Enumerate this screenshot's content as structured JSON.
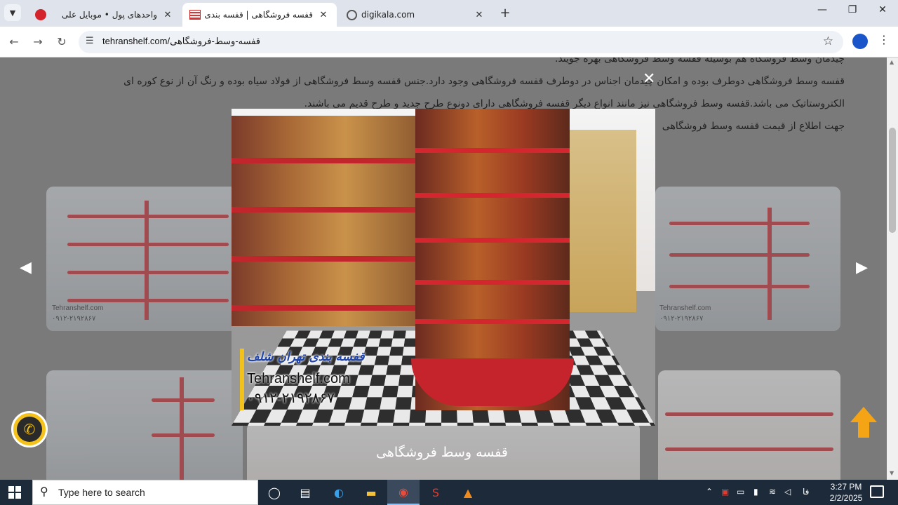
{
  "browser": {
    "tabs": [
      {
        "title": "واحدهای پول • موبایل علی",
        "favicon": "red-circle-icon",
        "active": false
      },
      {
        "title": "قفسه فروشگاهی | قفسه بندی فروشگاه",
        "favicon": "tehranshelf-icon",
        "active": true
      },
      {
        "title": "digikala.com",
        "favicon": "globe-icon",
        "active": false
      }
    ],
    "new_tab_symbol": "+",
    "url": "tehranshelf.com/قفسه-وسط-فروشگاهی"
  },
  "article": {
    "lines": [
      "چیدمان وسط فروشگاه هم بوسیله قفسه وسط فروشگاهی بهره جویند.",
      "قفسه وسط فروشگاهی دوطرف بوده و امکان چیدمان اجناس در دوطرف قفسه فروشگاهی وجود دارد.جنس قفسه وسط فروشگاهی از فولاد سیاه بوده و رنگ آن از نوع کوره ای",
      "الکتروستاتیک می باشد.قفسه وسط فروشگاهی نیز مانند انواع دیگر قفسه فروشگاهی دارای دونوع طرح جدید و طرح قدیم می باشند.",
      "جهت اطلاع از قیمت قفسه وسط فروشگاهی"
    ]
  },
  "gallery": {
    "watermark_site": "Tehranshelf.com",
    "watermark_phone": "۰۹۱۲-۲۱۹۲۸۶۷",
    "caption": "قفسه وسط فروشگاهی"
  },
  "lightbox": {
    "brand_name": "قفسه بندی تهران شلف",
    "brand_site": "Tehranshelf.com",
    "brand_phone": "۰۹۱۲-۲۱۹۲۸۶۷",
    "close_symbol": "✕"
  },
  "taskbar": {
    "search_placeholder": "Type here to search",
    "tray_lang": "فا",
    "time": "3:27 PM",
    "date": "2/2/2025"
  },
  "colors": {
    "shelf_red": "#c0262c",
    "accent_yellow": "#f5c21b",
    "totop_orange": "#f5a416"
  }
}
